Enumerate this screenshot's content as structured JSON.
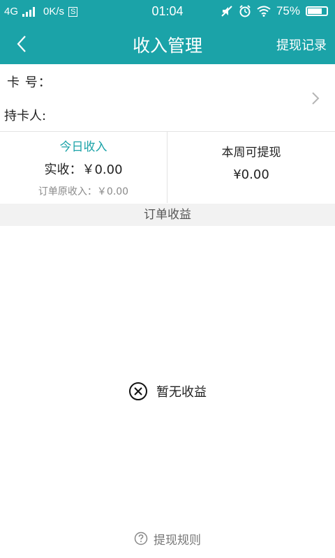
{
  "status_bar": {
    "network": "4G",
    "speed": "0K/s",
    "sim": "S",
    "time": "01:04",
    "battery": "75%",
    "battery_level": 0.75
  },
  "header": {
    "title": "收入管理",
    "right_action": "提现记录"
  },
  "card": {
    "card_number_label": "卡 号：",
    "holder_label": "持卡人:"
  },
  "today": {
    "title": "今日收入",
    "actual": "实收：￥0.00",
    "original": "订单原收入：￥0.00"
  },
  "week": {
    "title": "本周可提现",
    "value": "¥0.00"
  },
  "section": {
    "title": "订单收益"
  },
  "empty_state": {
    "text": "暂无收益"
  },
  "footer": {
    "rules": "提现规则"
  },
  "colors": {
    "accent": "#1ba3a8"
  }
}
